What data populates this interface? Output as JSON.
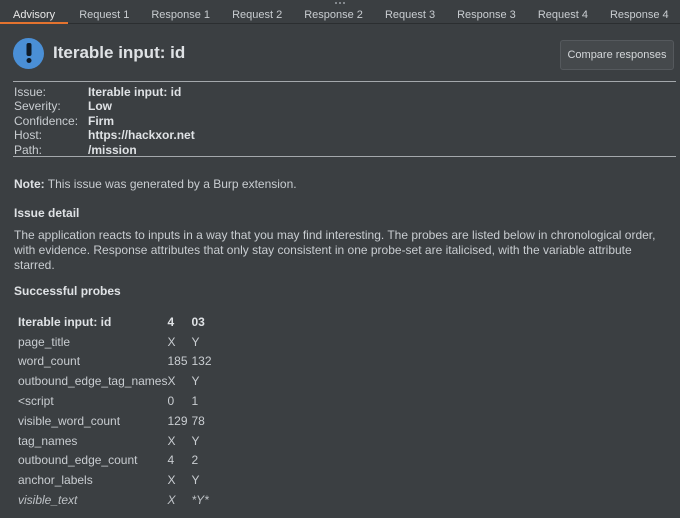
{
  "tabs": [
    {
      "label": "Advisory",
      "active": true
    },
    {
      "label": "Request 1"
    },
    {
      "label": "Response 1"
    },
    {
      "label": "Request 2"
    },
    {
      "label": "Response 2"
    },
    {
      "label": "Request 3"
    },
    {
      "label": "Response 3"
    },
    {
      "label": "Request 4"
    },
    {
      "label": "Response 4"
    }
  ],
  "advisory": {
    "icon": "info-icon",
    "accent_color": "#4a8fd6",
    "title": "Iterable input: id",
    "compare_button": "Compare responses",
    "meta": [
      {
        "key": "Issue:",
        "value": "Iterable input: id"
      },
      {
        "key": "Severity:",
        "value": "Low"
      },
      {
        "key": "Confidence:",
        "value": "Firm"
      },
      {
        "key": "Host:",
        "value": "https://hackxor.net"
      },
      {
        "key": "Path:",
        "value": "/mission"
      }
    ],
    "note_label": "Note:",
    "note_text": " This issue was generated by a Burp extension.",
    "detail_heading": "Issue detail",
    "detail_text": "The application reacts to inputs in a way that you may find interesting. The probes are listed below in chronological order, with evidence. Response attributes that only stay consistent in one probe-set are italicised, with the variable attribute starred.",
    "probes_heading": "Successful probes",
    "probes": {
      "header": [
        "Iterable input: id",
        "4",
        "03"
      ],
      "rows": [
        {
          "cells": [
            "page_title",
            "X",
            "Y"
          ]
        },
        {
          "cells": [
            "word_count",
            "185",
            "132"
          ]
        },
        {
          "cells": [
            "outbound_edge_tag_names",
            "X",
            "Y"
          ]
        },
        {
          "cells": [
            "<script",
            "0",
            "1"
          ]
        },
        {
          "cells": [
            "visible_word_count",
            "129",
            "78"
          ]
        },
        {
          "cells": [
            "tag_names",
            "X",
            "Y"
          ]
        },
        {
          "cells": [
            "outbound_edge_count",
            "4",
            "2"
          ]
        },
        {
          "cells": [
            "anchor_labels",
            "X",
            "Y"
          ]
        },
        {
          "cells": [
            "visible_text",
            "X",
            "*Y*"
          ],
          "italic": true
        }
      ]
    }
  }
}
